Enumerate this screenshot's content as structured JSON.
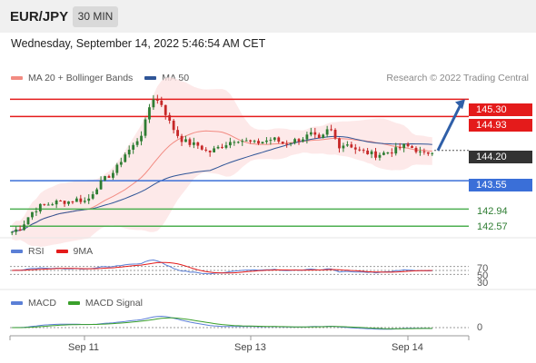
{
  "header": {
    "symbol": "EUR/JPY",
    "timeframe": "30 MIN",
    "datetime": "Wednesday, September 14, 2022 5:46:54 AM CET"
  },
  "legend_main": [
    {
      "label": "MA 20 + Bollinger Bands",
      "color": "#f28b82"
    },
    {
      "label": "MA 50",
      "color": "#2f5597"
    }
  ],
  "credit": "Research © 2022 Trading Central",
  "levels": {
    "resistance_2": "145.30",
    "resistance_1": "144.93",
    "last": "144.20",
    "pivot": "143.55",
    "support_1": "142.94",
    "support_2": "142.57"
  },
  "colors": {
    "resistance": "#e41b1b",
    "pivot": "#3a6fd8",
    "support": "#4caf50",
    "last": "#333333",
    "candle_up": "#2e7d32",
    "candle_down": "#c62828",
    "bollinger_fill": "#fde3e3",
    "ma20": "#f28b82",
    "ma50": "#2f5597",
    "arrow": "#2f5fa8"
  },
  "rsi_panel": {
    "legend": [
      {
        "label": "RSI",
        "color": "#5b7fd6"
      },
      {
        "label": "9MA",
        "color": "#e41b1b"
      }
    ],
    "levels": [
      "70",
      "50",
      "30"
    ]
  },
  "macd_panel": {
    "legend": [
      {
        "label": "MACD",
        "color": "#5b7fd6"
      },
      {
        "label": "MACD Signal",
        "color": "#3aa02b"
      }
    ],
    "zero_label": "0"
  },
  "x_axis": [
    "Sep 11",
    "Sep 13",
    "Sep 14"
  ],
  "chart_data": {
    "type": "candlestick",
    "timeframe": "30 MIN",
    "ylim": [
      142.4,
      145.6
    ],
    "close_path": [
      142.45,
      142.55,
      142.85,
      143.0,
      143.05,
      143.1,
      143.1,
      143.15,
      143.1,
      143.4,
      143.6,
      143.75,
      144.1,
      144.3,
      144.6,
      145.35,
      145.2,
      144.75,
      144.45,
      144.35,
      144.3,
      144.15,
      144.25,
      144.35,
      144.45,
      144.4,
      144.35,
      144.4,
      144.45,
      144.35,
      144.4,
      144.45,
      144.55,
      144.4,
      144.7,
      144.3,
      144.35,
      144.2,
      144.15,
      144.1,
      144.15,
      144.2,
      144.3,
      144.25,
      144.1,
      144.2
    ],
    "indicators": [
      "MA 20",
      "Bollinger Bands",
      "MA 50",
      "RSI",
      "9MA",
      "MACD",
      "MACD Signal"
    ],
    "projection": {
      "from": 144.2,
      "to": 145.3
    }
  }
}
